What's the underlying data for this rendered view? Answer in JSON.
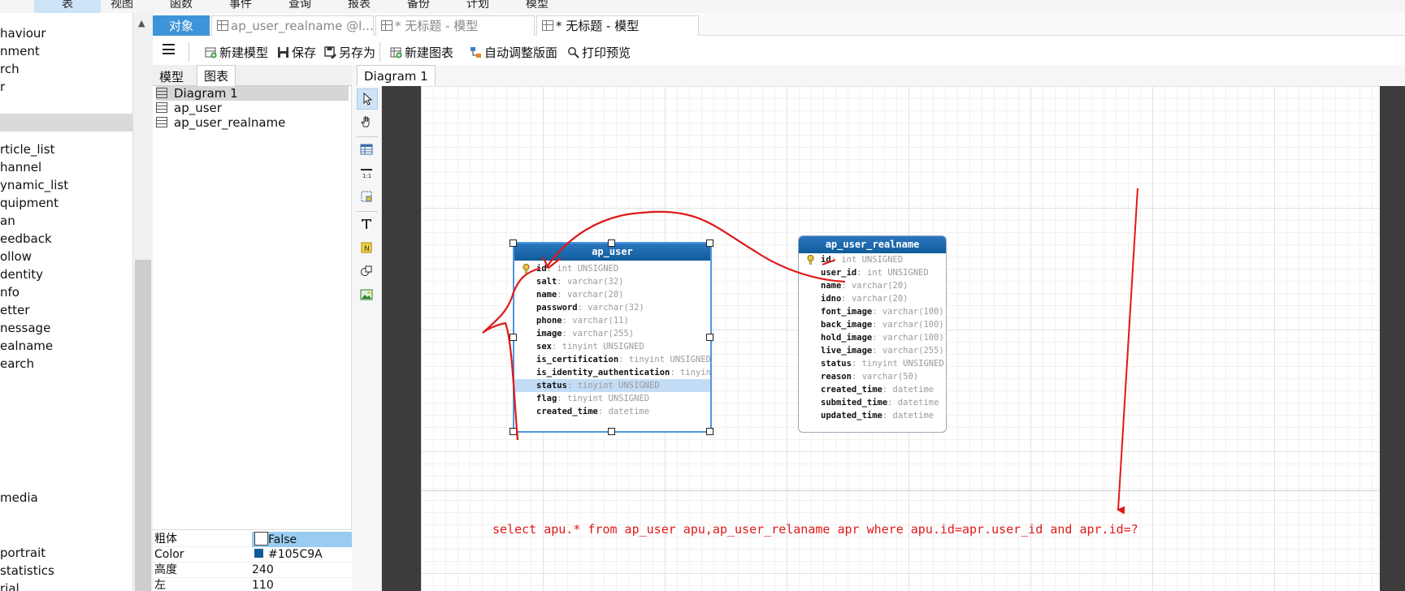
{
  "menubar": {
    "items": [
      {
        "label": "表",
        "active": true
      },
      {
        "label": "视图"
      },
      {
        "label": "函数"
      },
      {
        "label": "事件"
      },
      {
        "label": "查询"
      },
      {
        "label": "报表"
      },
      {
        "label": "备份"
      },
      {
        "label": "计划"
      },
      {
        "label": "模型"
      }
    ]
  },
  "left_list": {
    "items": [
      "haviour",
      "nment",
      "rch",
      "r",
      "",
      "",
      "rticle_list",
      "hannel",
      "ynamic_list",
      "quipment",
      "an",
      "eedback",
      "ollow",
      "dentity",
      "nfo",
      "etter",
      "nessage",
      "ealname",
      "earch",
      "media",
      "portrait",
      "statistics",
      "rial"
    ]
  },
  "tabs": {
    "objects": "对象",
    "tab1": "ap_user_realname @l...",
    "tab2": "* 无标题 - 模型",
    "tab3": "* 无标题 - 模型"
  },
  "toolbar": {
    "new_model": "新建模型",
    "save": "保存",
    "save_as": "另存为",
    "new_chart": "新建图表",
    "auto_layout": "自动调整版面",
    "print_preview": "打印预览"
  },
  "nav": {
    "tab_model": "模型",
    "tab_chart": "图表",
    "items": [
      "Diagram 1",
      "ap_user",
      "ap_user_realname"
    ]
  },
  "properties": {
    "rows": [
      {
        "key": "粗体",
        "value": "False"
      },
      {
        "key": "Color",
        "value": "#105C9A"
      },
      {
        "key": "高度",
        "value": "240"
      },
      {
        "key": "左",
        "value": "110"
      }
    ]
  },
  "diagram": {
    "tab_label": "Diagram 1",
    "entities": [
      {
        "name": "ap_user",
        "fields": [
          {
            "name": "id",
            "type": "int UNSIGNED",
            "key": true
          },
          {
            "name": "salt",
            "type": "varchar(32)"
          },
          {
            "name": "name",
            "type": "varchar(20)"
          },
          {
            "name": "password",
            "type": "varchar(32)"
          },
          {
            "name": "phone",
            "type": "varchar(11)"
          },
          {
            "name": "image",
            "type": "varchar(255)"
          },
          {
            "name": "sex",
            "type": "tinyint UNSIGNED"
          },
          {
            "name": "is_certification",
            "type": "tinyint UNSIGNED"
          },
          {
            "name": "is_identity_authentication",
            "type": "tinyint"
          },
          {
            "name": "status",
            "type": "tinyint UNSIGNED",
            "highlight": true
          },
          {
            "name": "flag",
            "type": "tinyint UNSIGNED"
          },
          {
            "name": "created_time",
            "type": "datetime"
          }
        ]
      },
      {
        "name": "ap_user_realname",
        "fields": [
          {
            "name": "id",
            "type": "int UNSIGNED",
            "key": true
          },
          {
            "name": "user_id",
            "type": "int UNSIGNED"
          },
          {
            "name": "name",
            "type": "varchar(20)"
          },
          {
            "name": "idno",
            "type": "varchar(20)"
          },
          {
            "name": "font_image",
            "type": "varchar(100)"
          },
          {
            "name": "back_image",
            "type": "varchar(100)"
          },
          {
            "name": "hold_image",
            "type": "varchar(100)"
          },
          {
            "name": "live_image",
            "type": "varchar(255)"
          },
          {
            "name": "status",
            "type": "tinyint UNSIGNED"
          },
          {
            "name": "reason",
            "type": "varchar(50)"
          },
          {
            "name": "created_time",
            "type": "datetime"
          },
          {
            "name": "submited_time",
            "type": "datetime"
          },
          {
            "name": "updated_time",
            "type": "datetime"
          }
        ]
      }
    ],
    "annotation_text": "select apu.* from ap_user apu,ap_user_relaname apr where apu.id=apr.user_id and apr.id=?"
  },
  "colors": {
    "accent": "#3d94d8",
    "entity_header": "#105C9A",
    "annotation": "#e01818"
  }
}
